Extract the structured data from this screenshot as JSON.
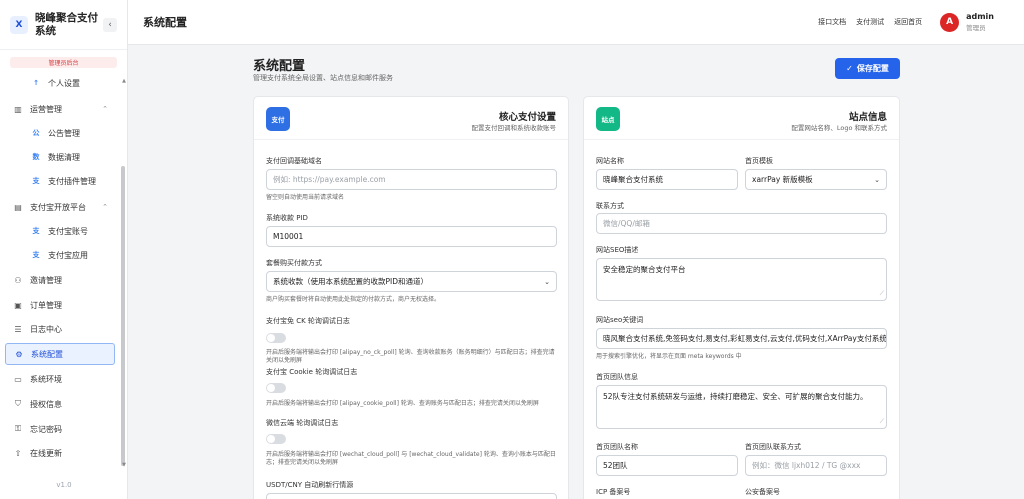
{
  "sidebar": {
    "brand_logo": "X",
    "brand_name": "晓峰聚合支付系统",
    "collapse": "‹",
    "role_badge": "管理员后台",
    "version": "v1.0",
    "items": [
      {
        "label": "个人设置",
        "icon": "arrow-up-icon",
        "glyph": "↑",
        "level": "sub"
      },
      {
        "label": "运营管理",
        "icon": "chart-icon",
        "glyph": "▥",
        "level": "top",
        "arrow": "⌃"
      },
      {
        "label": "公告管理",
        "icon": "gong-icon",
        "glyph": "公",
        "level": "sub"
      },
      {
        "label": "数据清理",
        "icon": "shu-icon",
        "glyph": "数",
        "level": "sub"
      },
      {
        "label": "支付插件管理",
        "icon": "zhi-icon",
        "glyph": "支",
        "level": "sub"
      },
      {
        "label": "支付宝开放平台",
        "icon": "window-icon",
        "glyph": "▤",
        "level": "top",
        "arrow": "⌃"
      },
      {
        "label": "支付宝账号",
        "icon": "zhi-icon",
        "glyph": "支",
        "level": "sub"
      },
      {
        "label": "支付宝应用",
        "icon": "zhi-icon",
        "glyph": "支",
        "level": "sub"
      },
      {
        "label": "邀请管理",
        "icon": "user-plus-icon",
        "glyph": "⚇",
        "level": "top"
      },
      {
        "label": "订单管理",
        "icon": "clipboard-icon",
        "glyph": "▣",
        "level": "top"
      },
      {
        "label": "日志中心",
        "icon": "log-icon",
        "glyph": "☰",
        "level": "top"
      },
      {
        "label": "系统配置",
        "icon": "gear-icon",
        "glyph": "⚙",
        "level": "top",
        "active": true
      },
      {
        "label": "系统环境",
        "icon": "monitor-icon",
        "glyph": "▭",
        "level": "top"
      },
      {
        "label": "授权信息",
        "icon": "shield-icon",
        "glyph": "⛉",
        "level": "top"
      },
      {
        "label": "忘记密码",
        "icon": "key-icon",
        "glyph": "⚿",
        "level": "top"
      },
      {
        "label": "在线更新",
        "icon": "upload-icon",
        "glyph": "⇧",
        "level": "top"
      }
    ]
  },
  "header": {
    "title": "系统配置",
    "links": [
      "接口文档",
      "支付测试",
      "返回首页"
    ],
    "avatar": "A",
    "user_name": "admin",
    "user_role": "管理员"
  },
  "main": {
    "title": "系统配置",
    "subtitle": "管理支付系统全局设置、站点信息和邮件服务",
    "save_label": "保存配置",
    "save_icon": "✓"
  },
  "core_card": {
    "badge": "支付",
    "badge_color": "#2f6fe4",
    "title": "核心支付设置",
    "desc": "配置支付回调和系统收款账号",
    "callback_label": "支付回调基础域名",
    "callback_placeholder": "例如: https://pay.example.com",
    "callback_hint": "留空则自动使用当前请求域名",
    "pid_label": "系统收款 PID",
    "pid_value": "M10001",
    "pay_method_label": "套餐购买付款方式",
    "pay_method_value": "系统收款（使用本系统配置的收款PID和通道）",
    "pay_method_hint": "商户购买套餐时将自动使用此处指定的付款方式，商户无权选择。",
    "ck_label": "支付宝免 CK 轮询调试日志",
    "ck_hint": "开启后服务端将输出会打印 [alipay_no_ck_poll] 轮询、查询收款账务（账务明细行）与匹配日志；排查完请关闭以免刷屏",
    "cookie_label": "支付宝 Cookie 轮询调试日志",
    "cookie_hint": "开启后服务端将输出会打印 [alipay_cookie_poll] 轮询、查询账务与匹配日志；排查完请关闭以免刷屏",
    "wechat_label": "微信云端 轮询调试日志",
    "wechat_hint": "开启后服务端将输出会打印 [wechat_cloud_poll] 与 [wechat_cloud_validate] 轮询、查询小账本与匹配日志；排查完请关闭以免刷屏",
    "usdt_label": "USDT/CNY 自动刷新行情源"
  },
  "site_card": {
    "badge": "站点",
    "badge_color": "#12b886",
    "title": "站点信息",
    "desc": "配置网站名称、Logo 和联系方式",
    "site_name_label": "网站名称",
    "site_name_value": "晓峰聚合支付系统",
    "template_label": "首页模板",
    "template_value": "xarrPay 新版模板",
    "contact_label": "联系方式",
    "contact_placeholder": "微信/QQ/邮箱",
    "seo_desc_label": "网站SEO描述",
    "seo_desc_value": "安全稳定的聚合支付平台",
    "seo_kw_label": "网站seo关键词",
    "seo_kw_value": "晓风聚合支付系统,免签码支付,易支付,彩虹易支付,云支付,优码支付,XArrPay支付系统",
    "seo_kw_hint": "用于搜索引擎优化，将显示在页面 meta keywords 中",
    "team_info_label": "首页团队信息",
    "team_info_value": "52队专注支付系统研发与运维，持续打磨稳定、安全、可扩展的聚合支付能力。",
    "team_name_label": "首页团队名称",
    "team_name_value": "52团队",
    "team_contact_label": "首页团队联系方式",
    "team_contact_placeholder": "例如：微信 ljxh012 / TG @xxx",
    "icp_label": "ICP 备案号",
    "police_label": "公安备案号"
  }
}
